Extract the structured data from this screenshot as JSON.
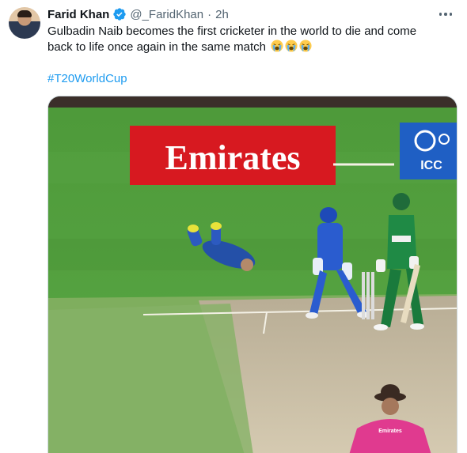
{
  "tweet": {
    "display_name": "Farid Khan",
    "handle": "@_FaridKhan",
    "separator": "·",
    "time": "2h",
    "text": "Gulbadin Naib becomes the first cricketer in the world to die and come back to life once again in the same match",
    "emojis": [
      "loudly-crying-face",
      "loudly-crying-face",
      "loudly-crying-face"
    ],
    "hashtag": "#T20WorldCup",
    "verified": true
  },
  "media": {
    "banner_text": "Emirates",
    "icc_text": "ICC",
    "umpire_shirt_text": "Emirates"
  },
  "colors": {
    "link": "#1d9bf0",
    "secondary_text": "#536471",
    "verified": "#1d9bf0",
    "banner_red": "#d71920",
    "icc_blue": "#1f5fc4"
  }
}
